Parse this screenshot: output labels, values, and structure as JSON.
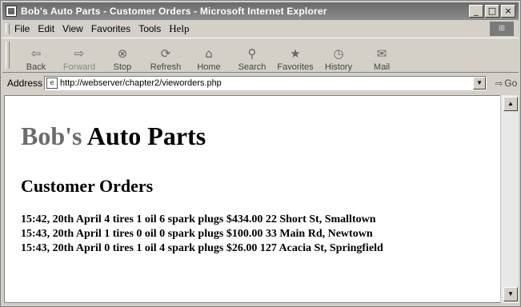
{
  "window": {
    "title": "Bob's Auto Parts - Customer Orders - Microsoft Internet Explorer",
    "controls": [
      "_",
      "□",
      "×"
    ]
  },
  "menu": [
    "File",
    "Edit",
    "View",
    "Favorites",
    "Tools",
    "Help"
  ],
  "toolbar": {
    "back": "Back",
    "forward": "Forward",
    "stop": "Stop",
    "refresh": "Refresh",
    "home": "Home",
    "search": "Search",
    "favorites": "Favorites",
    "history": "History",
    "mail": "Mail"
  },
  "address": {
    "label": "Address",
    "url": "http://webserver/chapter2/vieworders.php",
    "go": "Go"
  },
  "page": {
    "brand": "Bob's",
    "title_rest": "Auto Parts",
    "heading": "Customer Orders",
    "orders": [
      "15:42, 20th April 4 tires 1 oil 6 spark plugs $434.00 22 Short St, Smalltown",
      "15:43, 20th April 1 tires 0 oil 0 spark plugs $100.00 33 Main Rd, Newtown",
      "15:43, 20th April 0 tires 1 oil 4 spark plugs $26.00 127 Acacia St, Springfield"
    ]
  }
}
